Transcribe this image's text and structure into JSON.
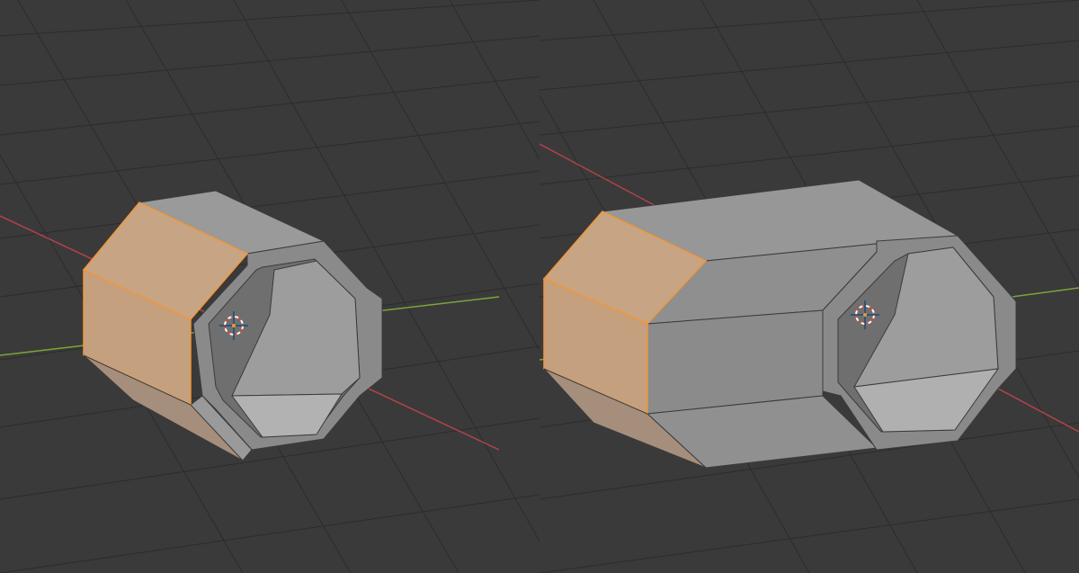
{
  "colors": {
    "background": "#3a3a3a",
    "grid": "#2c2c2c",
    "x_axis": "#b3424a",
    "y_axis": "#7ca53b",
    "mesh_face": "#8e8e8e",
    "mesh_face_light": "#a4a4a4",
    "mesh_face_dark": "#7c7c7c",
    "mesh_edge": "#3b3b3b",
    "selected_face": "#c7a584",
    "selected_edge": "#f0963a",
    "cursor_red": "#e0413b",
    "cursor_white": "#ffffff"
  },
  "viewports": [
    {
      "id": "left",
      "mesh": "octagon-tube-short",
      "selected_face": "front-left",
      "icons": [
        "3d-cursor-icon"
      ]
    },
    {
      "id": "right",
      "mesh": "octagon-tube-long",
      "selected_face": "front-left",
      "icons": [
        "3d-cursor-icon"
      ]
    }
  ]
}
